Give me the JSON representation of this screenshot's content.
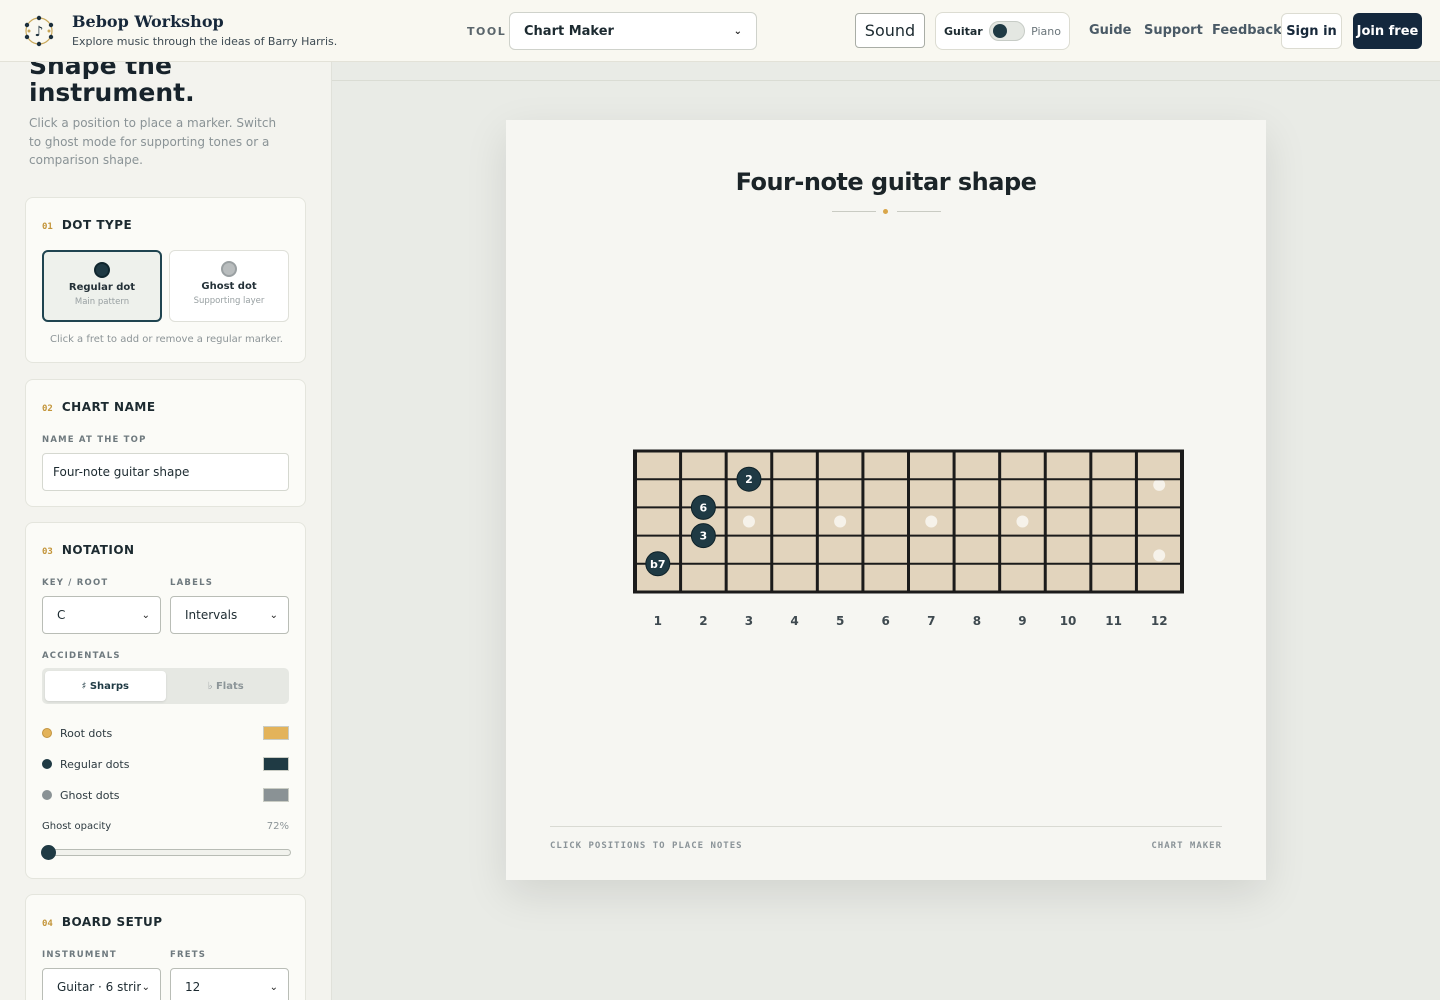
{
  "header": {
    "brand_title": "Bebop Workshop",
    "brand_subtitle": "Explore music through the ideas of Barry Harris.",
    "tool_label": "TOOL",
    "tool_selected": "Chart Maker",
    "sound_label": "Sound",
    "instrument_left": "Guitar",
    "instrument_right": "Piano",
    "nav": [
      "Guide",
      "Support",
      "Feedback"
    ],
    "signin_label": "Sign in",
    "join_label": "Join free"
  },
  "sidebar": {
    "heading": "Shape the instrument.",
    "description": "Click a position to place a marker. Switch to ghost mode for supporting tones or a comparison shape.",
    "dot_type": {
      "num": "01",
      "title": "DOT TYPE",
      "options": [
        {
          "label": "Regular dot",
          "sub": "Main pattern",
          "color": "#1f3a44",
          "active": true
        },
        {
          "label": "Ghost dot",
          "sub": "Supporting layer",
          "color": "#b9bdbe",
          "active": false
        }
      ],
      "hint": "Click a fret to add or remove a regular marker."
    },
    "chart_name": {
      "num": "02",
      "title": "CHART NAME",
      "field_label": "NAME AT THE TOP",
      "value": "Four-note guitar shape"
    },
    "notation": {
      "num": "03",
      "title": "NOTATION",
      "key_label": "KEY / ROOT",
      "key_value": "C",
      "labels_label": "LABELS",
      "labels_value": "Intervals",
      "accidentals_label": "ACCIDENTALS",
      "sharps_label": "♯ Sharps",
      "flats_label": "♭ Flats",
      "colors": [
        {
          "label": "Root dots",
          "color": "#e3b35a"
        },
        {
          "label": "Regular dots",
          "color": "#1f3a44"
        },
        {
          "label": "Ghost dots",
          "color": "#8a9295"
        }
      ],
      "opacity_label": "Ghost opacity",
      "opacity_value": "72%",
      "opacity_fraction": 0.72
    },
    "board_setup": {
      "num": "04",
      "title": "BOARD SETUP",
      "instrument_label": "INSTRUMENT",
      "instrument_value": "Guitar · 6 strir",
      "frets_label": "FRETS",
      "frets_value": "12"
    }
  },
  "sheet": {
    "title": "Four-note guitar shape",
    "footer_left": "CLICK POSITIONS TO PLACE NOTES",
    "footer_right": "CHART MAKER",
    "fret_count": 12,
    "string_count": 6,
    "fret_numbers": [
      "1",
      "2",
      "3",
      "4",
      "5",
      "6",
      "7",
      "8",
      "9",
      "10",
      "11",
      "12"
    ],
    "inlay_frets": [
      3,
      5,
      7,
      9
    ],
    "double_inlay_fret": 12,
    "notes": [
      {
        "label": "2",
        "fret": 3,
        "string": 2
      },
      {
        "label": "6",
        "fret": 2,
        "string": 3
      },
      {
        "label": "3",
        "fret": 2,
        "string": 4
      },
      {
        "label": "b7",
        "fret": 1,
        "string": 5
      }
    ]
  }
}
